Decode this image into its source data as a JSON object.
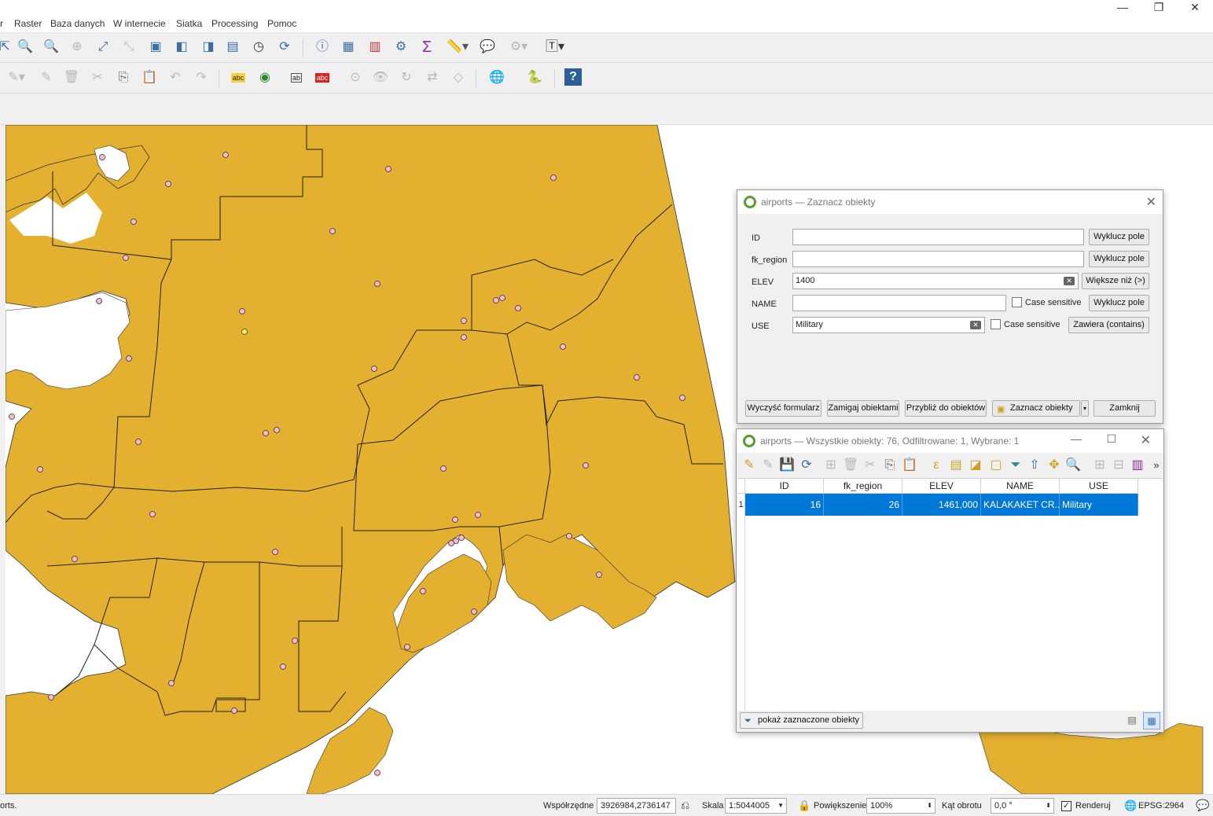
{
  "window": {
    "minimize": "—",
    "maximize": "❐",
    "close": "✕"
  },
  "menu": [
    "r",
    "Raster",
    "Baza danych",
    "W internecie",
    "Siatka",
    "Processing",
    "Pomoc"
  ],
  "select_dialog": {
    "title": "airports — Zaznacz obiekty",
    "fields": [
      {
        "label": "ID",
        "value": "",
        "operator": "Wyklucz pole"
      },
      {
        "label": "fk_region",
        "value": "",
        "operator": "Wyklucz pole"
      },
      {
        "label": "ELEV",
        "value": "1400",
        "operator": "Większe niż (>)"
      },
      {
        "label": "NAME",
        "value": "",
        "operator": "Wyklucz pole",
        "case": "Case sensitive"
      },
      {
        "label": "USE",
        "value": "Military",
        "operator": "Zawiera (contains)",
        "case": "Case sensitive"
      }
    ],
    "buttons": {
      "clear": "Wyczyść formularz",
      "flash": "Zamigaj obiektami",
      "zoom": "Przybliż do obiektów",
      "select": "Zaznacz obiekty",
      "close": "Zamknij"
    }
  },
  "table_dialog": {
    "title": "airports — Wszystkie obiekty: 76, Odfiltrowane: 1, Wybrane: 1",
    "columns": [
      "ID",
      "fk_region",
      "ELEV",
      "NAME",
      "USE"
    ],
    "rows": [
      {
        "n": "1",
        "cells": [
          "16",
          "26",
          "1461,000",
          "KALAKAKET CR...",
          "Military"
        ]
      }
    ],
    "filter_button": "pokaż zaznaczone obiekty"
  },
  "status": {
    "message": "orts.",
    "coord_label": "Współrzędne",
    "coord_value": "3926984,2736147",
    "scale_label": "Skala",
    "scale_value": "1:5044005",
    "magnifier_label": "Powiększenie",
    "magnifier_value": "100%",
    "rotation_label": "Kąt obrotu",
    "rotation_value": "0,0 °",
    "render_label": "Renderuj",
    "crs": "EPSG:2964"
  },
  "colors": {
    "land": "#e3b030",
    "point": "#f5b8d8",
    "point_selected": "#f5f54a",
    "selection": "#0078d7"
  }
}
